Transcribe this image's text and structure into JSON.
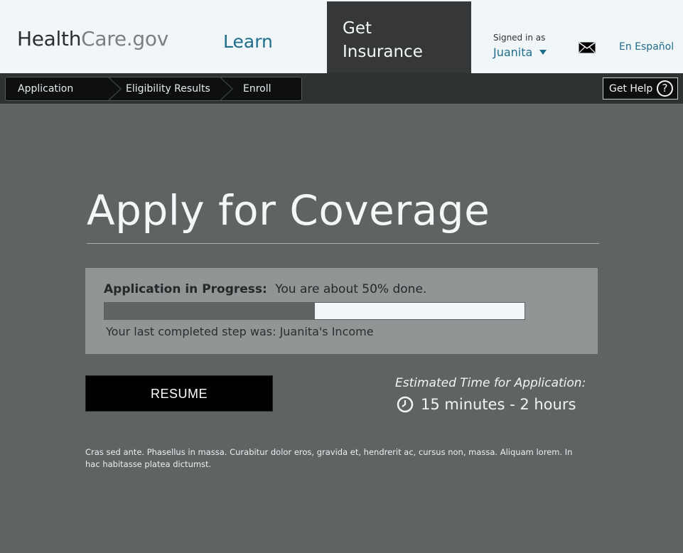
{
  "header": {
    "logo_part1": "Health",
    "logo_part2": "Care.gov",
    "nav_learn": "Learn",
    "nav_insurance_line1": "Get",
    "nav_insurance_line2": "Insurance",
    "signed_in_label": "Signed in as",
    "user_name": "Juanita",
    "language_link": "En Español",
    "mail_icon": "envelope-icon"
  },
  "breadcrumb": {
    "steps": [
      "Application",
      "Eligibility Results",
      "Enroll"
    ]
  },
  "help": {
    "label": "Get Help",
    "icon_glyph": "?"
  },
  "main": {
    "title": "Apply for Coverage",
    "progress_label": "Application in Progress:",
    "progress_status": "You are about 50% done.",
    "progress_percent": 50,
    "last_step": "Your last completed step was: Juanita's Income",
    "resume_label": "RESUME",
    "estimate_label": "Estimated Time for Application:",
    "estimate_value": "15 minutes - 2 hours",
    "footer_text": "Cras sed ante. Phasellus in massa. Curabitur dolor eros, gravida et, hendrerit ac, cursus non, massa. Aliquam lorem. In hac habitasse platea dictumst."
  },
  "colors": {
    "accent": "#1f6d8a",
    "page_background": "#5f6364",
    "header_background": "#f1f6f9",
    "active_nav": "#353738"
  }
}
